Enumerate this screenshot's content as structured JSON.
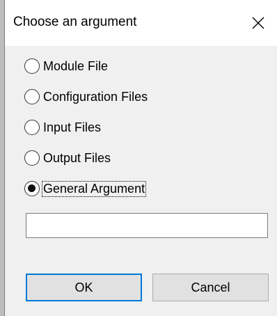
{
  "dialog": {
    "title": "Choose an argument",
    "close_icon": "close-icon",
    "options": [
      {
        "label": "Module File",
        "checked": false
      },
      {
        "label": "Configuration Files",
        "checked": false
      },
      {
        "label": "Input Files",
        "checked": false
      },
      {
        "label": "Output Files",
        "checked": false
      },
      {
        "label": "General Argument",
        "checked": true
      }
    ],
    "argument_input": {
      "value": "",
      "placeholder": ""
    },
    "buttons": {
      "ok": "OK",
      "cancel": "Cancel"
    }
  }
}
